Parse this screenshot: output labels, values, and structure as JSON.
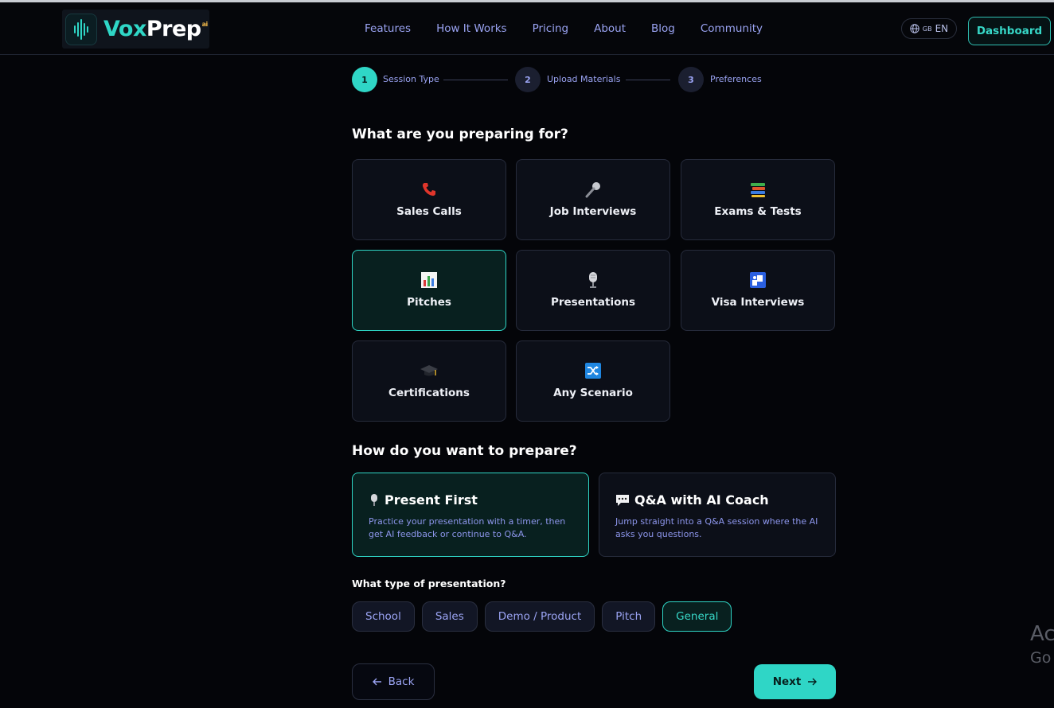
{
  "header": {
    "logo": {
      "text_a": "Vox",
      "text_b": "Prep",
      "sup": "ai"
    },
    "nav": [
      "Features",
      "How It Works",
      "Pricing",
      "About",
      "Blog",
      "Community"
    ],
    "language": {
      "flag": "GB",
      "code": "EN"
    },
    "dashboard_label": "Dashboard"
  },
  "stepper": [
    {
      "number": "1",
      "label": "Session Type",
      "active": true
    },
    {
      "number": "2",
      "label": "Upload Materials",
      "active": false
    },
    {
      "number": "3",
      "label": "Preferences",
      "active": false
    }
  ],
  "session_section": {
    "title": "What are you preparing for?",
    "options": [
      {
        "label": "Sales Calls",
        "icon": "phone-icon",
        "selected": false
      },
      {
        "label": "Job Interviews",
        "icon": "microphone-icon",
        "selected": false
      },
      {
        "label": "Exams & Tests",
        "icon": "books-icon",
        "selected": false
      },
      {
        "label": "Pitches",
        "icon": "bar-chart-icon",
        "selected": true
      },
      {
        "label": "Presentations",
        "icon": "studio-microphone-icon",
        "selected": false
      },
      {
        "label": "Visa Interviews",
        "icon": "passport-control-icon",
        "selected": false
      },
      {
        "label": "Certifications",
        "icon": "graduation-cap-icon",
        "selected": false
      },
      {
        "label": "Any Scenario",
        "icon": "shuffle-icon",
        "selected": false
      }
    ]
  },
  "prepare_section": {
    "title": "How do you want to prepare?",
    "modes": [
      {
        "title": "Present First",
        "icon": "studio-microphone-icon",
        "description": "Practice your presentation with a timer, then get AI feedback or continue to Q&A.",
        "selected": true
      },
      {
        "title": "Q&A with AI Coach",
        "icon": "speech-bubble-icon",
        "description": "Jump straight into a Q&A session where the AI asks you questions.",
        "selected": false
      }
    ]
  },
  "presentation_type": {
    "title": "What type of presentation?",
    "chips": [
      {
        "label": "School",
        "selected": false
      },
      {
        "label": "Sales",
        "selected": false
      },
      {
        "label": "Demo / Product",
        "selected": false
      },
      {
        "label": "Pitch",
        "selected": false
      },
      {
        "label": "General",
        "selected": true
      }
    ]
  },
  "footer": {
    "back_label": "Back",
    "next_label": "Next"
  },
  "watermark": {
    "line1": "Ac",
    "line2": "Go"
  },
  "colors": {
    "accent": "#2fd6c6",
    "nav": "#9aa3f2",
    "background": "#040509"
  }
}
